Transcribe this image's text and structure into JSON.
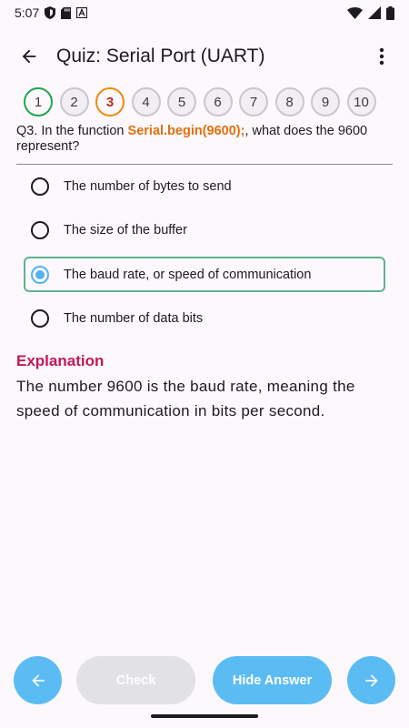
{
  "status_bar": {
    "time": "5:07"
  },
  "app_bar": {
    "title": "Quiz: Serial Port (UART)"
  },
  "progress": {
    "questions": [
      {
        "label": "1",
        "state": "correct"
      },
      {
        "label": "2",
        "state": "unanswered"
      },
      {
        "label": "3",
        "state": "current"
      },
      {
        "label": "4",
        "state": "unanswered"
      },
      {
        "label": "5",
        "state": "unanswered"
      },
      {
        "label": "6",
        "state": "unanswered"
      },
      {
        "label": "7",
        "state": "unanswered"
      },
      {
        "label": "8",
        "state": "unanswered"
      },
      {
        "label": "9",
        "state": "unanswered"
      },
      {
        "label": "10",
        "state": "unanswered"
      }
    ]
  },
  "question": {
    "prefix": "Q3. In the function ",
    "code": "Serial.begin(9600);",
    "suffix": ", what does the 9600 represent?"
  },
  "options": [
    {
      "label": "The number of bytes to send",
      "selected": false
    },
    {
      "label": "The size of the buffer",
      "selected": false
    },
    {
      "label": "The baud rate, or speed of communication",
      "selected": true
    },
    {
      "label": "The number of data bits",
      "selected": false
    }
  ],
  "explanation": {
    "title": "Explanation",
    "body": "The number 9600 is the baud rate, meaning the speed of communication in bits per second."
  },
  "bottom_bar": {
    "check_label": "Check",
    "hide_answer_label": "Hide Answer"
  },
  "colors": {
    "accent": "#5bbcf4",
    "correct": "#1fa84f",
    "current": "#f08a12",
    "code": "#e0700e",
    "explanation_title": "#c2185b",
    "selected_border": "#5fb391"
  },
  "icons": {
    "back": "arrow-left-icon",
    "more": "more-vert-icon",
    "prev": "arrow-left-icon",
    "next": "arrow-right-icon"
  }
}
